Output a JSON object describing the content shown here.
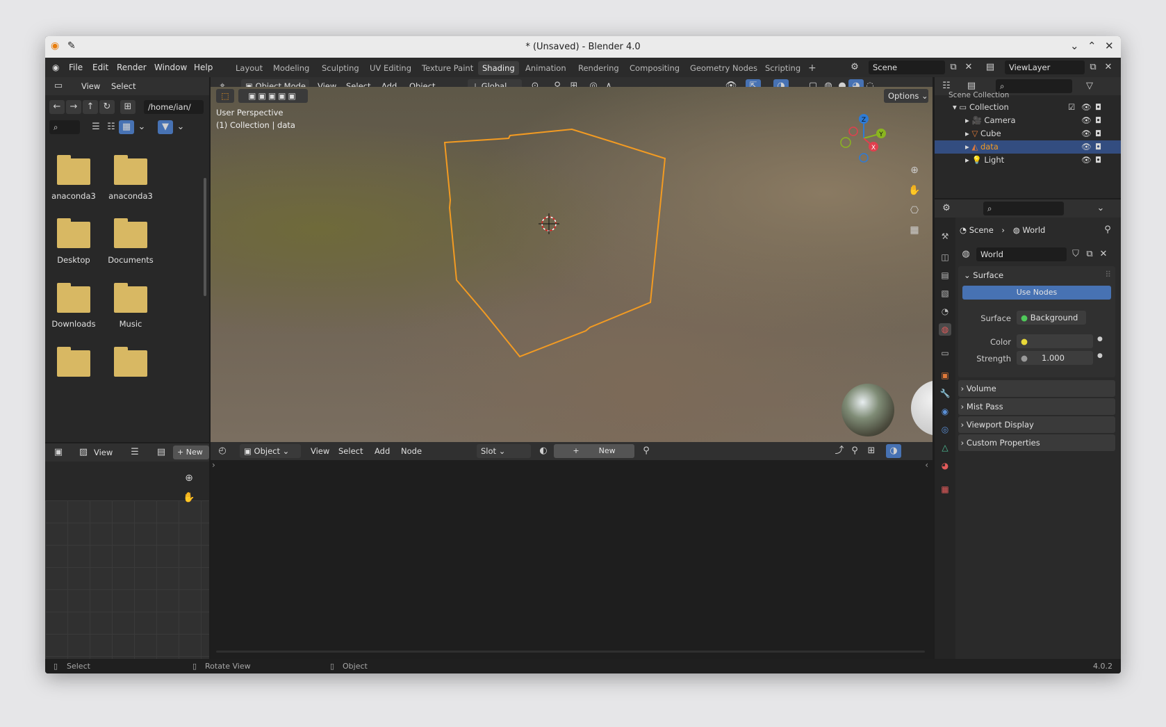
{
  "window": {
    "title": "* (Unsaved) - Blender 4.0",
    "version": "4.0.2"
  },
  "menu": [
    "File",
    "Edit",
    "Render",
    "Window",
    "Help"
  ],
  "workspaces": [
    {
      "label": "Layout"
    },
    {
      "label": "Modeling"
    },
    {
      "label": "Sculpting"
    },
    {
      "label": "UV Editing"
    },
    {
      "label": "Texture Paint"
    },
    {
      "label": "Shading"
    },
    {
      "label": "Animation"
    },
    {
      "label": "Rendering"
    },
    {
      "label": "Compositing"
    },
    {
      "label": "Geometry Nodes"
    },
    {
      "label": "Scripting"
    }
  ],
  "active_workspace": "Shading",
  "scene": "Scene",
  "view_layer": "ViewLayer",
  "filebrowser": {
    "view": "View",
    "select": "Select",
    "path": "/home/ian/",
    "items": [
      {
        "label": "anaconda3",
        "icon": "folder-icon"
      },
      {
        "label": "anaconda3",
        "icon": "folder-icon"
      },
      {
        "label": "Desktop",
        "icon": "desktop-folder-icon"
      },
      {
        "label": "Documents",
        "icon": "documents-folder-icon"
      },
      {
        "label": "Downloads",
        "icon": "downloads-folder-icon"
      },
      {
        "label": "Music",
        "icon": "music-folder-icon"
      },
      {
        "label": "",
        "icon": "pictures-folder-icon"
      },
      {
        "label": "",
        "icon": "folder-icon"
      }
    ]
  },
  "viewport": {
    "mode": "Object Mode",
    "view": "View",
    "select": "Select",
    "add": "Add",
    "object": "Object",
    "orientation": "Global",
    "options": "Options",
    "perspective": "User Perspective",
    "collection_info": "(1) Collection | data",
    "axes": {
      "x": "X",
      "y": "Y",
      "z": "Z"
    }
  },
  "image_editor": {
    "view": "View",
    "new": "New"
  },
  "node_editor": {
    "type": "Object",
    "view": "View",
    "select": "Select",
    "add": "Add",
    "node": "Node",
    "slot": "Slot",
    "new": "New"
  },
  "outliner": {
    "root": "Scene Collection",
    "collection": "Collection",
    "items": [
      {
        "label": "Camera",
        "selected": false
      },
      {
        "label": "Cube",
        "selected": false
      },
      {
        "label": "data",
        "selected": true
      },
      {
        "label": "Light",
        "selected": false
      }
    ]
  },
  "properties": {
    "breadcrumb_scene": "Scene",
    "breadcrumb_world": "World",
    "world_name": "World",
    "surface_panel": "Surface",
    "use_nodes": "Use Nodes",
    "surface_label": "Surface",
    "surface_value": "Background",
    "color_label": "Color",
    "strength_label": "Strength",
    "strength_value": "1.000",
    "panels": [
      "Volume",
      "Mist Pass",
      "Viewport Display",
      "Custom Properties"
    ]
  },
  "status": {
    "select": "Select",
    "rotate": "Rotate View",
    "object": "Object"
  },
  "colors": {
    "accent": "#4772b3",
    "selection": "#f39b22",
    "folder": "#d8b863"
  }
}
